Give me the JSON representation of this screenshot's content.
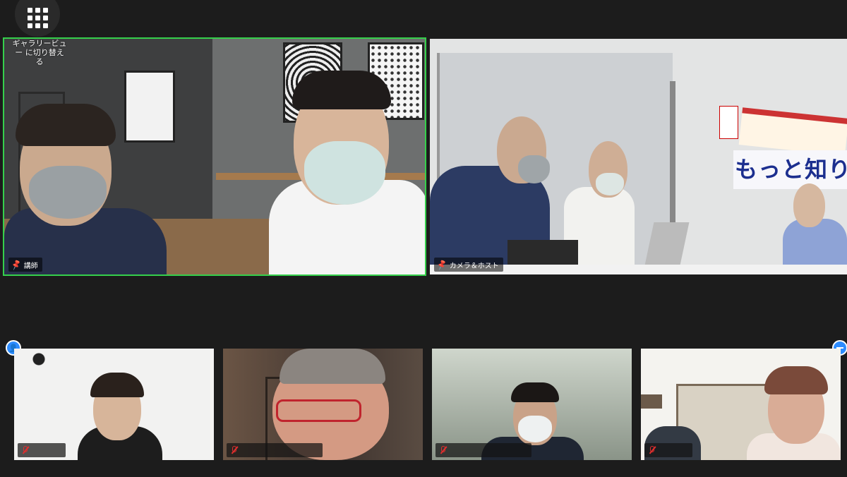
{
  "toolbar": {
    "menu_icon": "grid-menu-icon"
  },
  "main_tiles": [
    {
      "name": "講師",
      "pinned": true,
      "active": true
    },
    {
      "name": "カメラ＆ホスト",
      "pinned": true,
      "active": false
    }
  ],
  "gallery_switch": {
    "label": "ギャラリービュー に切り替える"
  },
  "banner_text": "もっと知りたい!",
  "thumbnails": [
    {
      "name": "",
      "muted": true
    },
    {
      "name": "",
      "muted": true
    },
    {
      "name": "",
      "muted": true
    },
    {
      "name": "",
      "muted": true
    }
  ],
  "colors": {
    "active_border": "#35d04b",
    "accent": "#2d8cff",
    "muted_mic": "#e02e2e",
    "background": "#1c1c1c"
  }
}
